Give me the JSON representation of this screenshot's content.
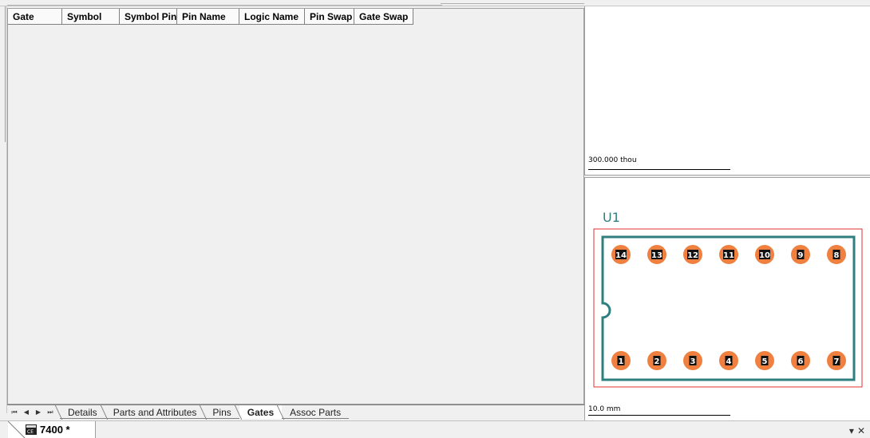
{
  "grid": {
    "columns": [
      {
        "label": "Gate"
      },
      {
        "label": "Symbol"
      },
      {
        "label": "Symbol Pin"
      },
      {
        "label": "Pin Name"
      },
      {
        "label": "Logic Name"
      },
      {
        "label": "Pin Swap"
      },
      {
        "label": "Gate Swap"
      }
    ]
  },
  "sheet_tabs": [
    {
      "label": "Details",
      "active": false
    },
    {
      "label": "Parts and Attributes",
      "active": false
    },
    {
      "label": "Pins",
      "active": false
    },
    {
      "label": "Gates",
      "active": true
    },
    {
      "label": "Assoc Parts",
      "active": false
    }
  ],
  "nav": {
    "first": "⏮",
    "prev": "◀",
    "next": "▶",
    "last": "⏭"
  },
  "preview_top": {
    "scale_label": "300.000 thou"
  },
  "preview_bottom": {
    "scale_label": "10.0 mm",
    "ref_designator": "U1",
    "top_pins": [
      "14",
      "13",
      "12",
      "11",
      "10",
      "9",
      "8"
    ],
    "bottom_pins": [
      "1",
      "2",
      "3",
      "4",
      "5",
      "6",
      "7"
    ],
    "pad_color": "#f08040",
    "outline_color": "#2f7f7f",
    "boundary_color": "#e03030"
  },
  "document_tab": {
    "title": "7400 *",
    "icon": "component-icon"
  },
  "window_controls": {
    "pin": "▾",
    "close": "✕"
  }
}
